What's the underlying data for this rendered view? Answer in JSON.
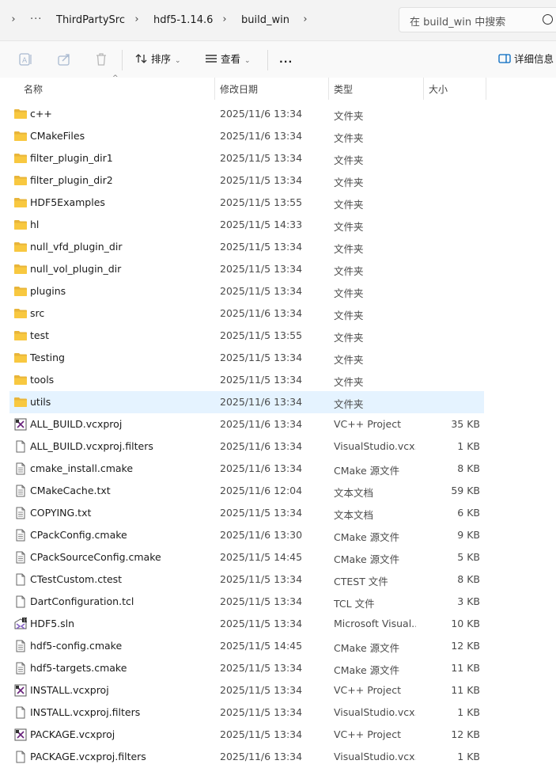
{
  "breadcrumb": [
    "ThirdPartySrc",
    "hdf5-1.14.6",
    "build_win"
  ],
  "search": {
    "placeholder": "在 build_win 中搜索"
  },
  "toolbar": {
    "sort_label": "排序",
    "view_label": "查看",
    "more_label": "...",
    "details_label": "详细信息"
  },
  "columns": {
    "name": "名称",
    "modified": "修改日期",
    "type": "类型",
    "size": "大小"
  },
  "files": [
    {
      "name": "c++",
      "modified": "2025/11/6 13:34",
      "type": "文件夹",
      "size": "",
      "icon": "folder-icon"
    },
    {
      "name": "CMakeFiles",
      "modified": "2025/11/6 13:34",
      "type": "文件夹",
      "size": "",
      "icon": "folder-icon"
    },
    {
      "name": "filter_plugin_dir1",
      "modified": "2025/11/5 13:34",
      "type": "文件夹",
      "size": "",
      "icon": "folder-icon"
    },
    {
      "name": "filter_plugin_dir2",
      "modified": "2025/11/5 13:34",
      "type": "文件夹",
      "size": "",
      "icon": "folder-icon"
    },
    {
      "name": "HDF5Examples",
      "modified": "2025/11/5 13:55",
      "type": "文件夹",
      "size": "",
      "icon": "folder-icon"
    },
    {
      "name": "hl",
      "modified": "2025/11/5 14:33",
      "type": "文件夹",
      "size": "",
      "icon": "folder-icon"
    },
    {
      "name": "null_vfd_plugin_dir",
      "modified": "2025/11/5 13:34",
      "type": "文件夹",
      "size": "",
      "icon": "folder-icon"
    },
    {
      "name": "null_vol_plugin_dir",
      "modified": "2025/11/5 13:34",
      "type": "文件夹",
      "size": "",
      "icon": "folder-icon"
    },
    {
      "name": "plugins",
      "modified": "2025/11/5 13:34",
      "type": "文件夹",
      "size": "",
      "icon": "folder-icon"
    },
    {
      "name": "src",
      "modified": "2025/11/6 13:34",
      "type": "文件夹",
      "size": "",
      "icon": "folder-icon"
    },
    {
      "name": "test",
      "modified": "2025/11/5 13:55",
      "type": "文件夹",
      "size": "",
      "icon": "folder-icon"
    },
    {
      "name": "Testing",
      "modified": "2025/11/5 13:34",
      "type": "文件夹",
      "size": "",
      "icon": "folder-icon"
    },
    {
      "name": "tools",
      "modified": "2025/11/5 13:34",
      "type": "文件夹",
      "size": "",
      "icon": "folder-icon"
    },
    {
      "name": "utils",
      "modified": "2025/11/6 13:34",
      "type": "文件夹",
      "size": "",
      "icon": "folder-icon",
      "selected": true
    },
    {
      "name": "ALL_BUILD.vcxproj",
      "modified": "2025/11/6 13:34",
      "type": "VC++ Project",
      "size": "35 KB",
      "icon": "vcxproj-icon"
    },
    {
      "name": "ALL_BUILD.vcxproj.filters",
      "modified": "2025/11/6 13:34",
      "type": "VisualStudio.vcx...",
      "size": "1 KB",
      "icon": "file-icon"
    },
    {
      "name": "cmake_install.cmake",
      "modified": "2025/11/6 13:34",
      "type": "CMake 源文件",
      "size": "8 KB",
      "icon": "text-file-icon"
    },
    {
      "name": "CMakeCache.txt",
      "modified": "2025/11/6 12:04",
      "type": "文本文档",
      "size": "59 KB",
      "icon": "text-file-icon"
    },
    {
      "name": "COPYING.txt",
      "modified": "2025/11/5 13:34",
      "type": "文本文档",
      "size": "6 KB",
      "icon": "text-file-icon"
    },
    {
      "name": "CPackConfig.cmake",
      "modified": "2025/11/6 13:30",
      "type": "CMake 源文件",
      "size": "9 KB",
      "icon": "text-file-icon"
    },
    {
      "name": "CPackSourceConfig.cmake",
      "modified": "2025/11/5 14:45",
      "type": "CMake 源文件",
      "size": "5 KB",
      "icon": "text-file-icon"
    },
    {
      "name": "CTestCustom.ctest",
      "modified": "2025/11/5 13:34",
      "type": "CTEST 文件",
      "size": "8 KB",
      "icon": "file-icon"
    },
    {
      "name": "DartConfiguration.tcl",
      "modified": "2025/11/5 13:34",
      "type": "TCL 文件",
      "size": "3 KB",
      "icon": "file-icon"
    },
    {
      "name": "HDF5.sln",
      "modified": "2025/11/5 13:34",
      "type": "Microsoft Visual...",
      "size": "10 KB",
      "icon": "sln-icon"
    },
    {
      "name": "hdf5-config.cmake",
      "modified": "2025/11/5 14:45",
      "type": "CMake 源文件",
      "size": "12 KB",
      "icon": "text-file-icon"
    },
    {
      "name": "hdf5-targets.cmake",
      "modified": "2025/11/5 13:34",
      "type": "CMake 源文件",
      "size": "11 KB",
      "icon": "text-file-icon"
    },
    {
      "name": "INSTALL.vcxproj",
      "modified": "2025/11/5 13:34",
      "type": "VC++ Project",
      "size": "11 KB",
      "icon": "vcxproj-icon"
    },
    {
      "name": "INSTALL.vcxproj.filters",
      "modified": "2025/11/5 13:34",
      "type": "VisualStudio.vcx...",
      "size": "1 KB",
      "icon": "file-icon"
    },
    {
      "name": "PACKAGE.vcxproj",
      "modified": "2025/11/5 13:34",
      "type": "VC++ Project",
      "size": "12 KB",
      "icon": "vcxproj-icon"
    },
    {
      "name": "PACKAGE.vcxproj.filters",
      "modified": "2025/11/6 13:34",
      "type": "VisualStudio.vcx...",
      "size": "1 KB",
      "icon": "file-icon"
    }
  ],
  "colors": {
    "folder": "#f8c840",
    "selection": "#e5f3ff",
    "accent": "#0067c0"
  }
}
